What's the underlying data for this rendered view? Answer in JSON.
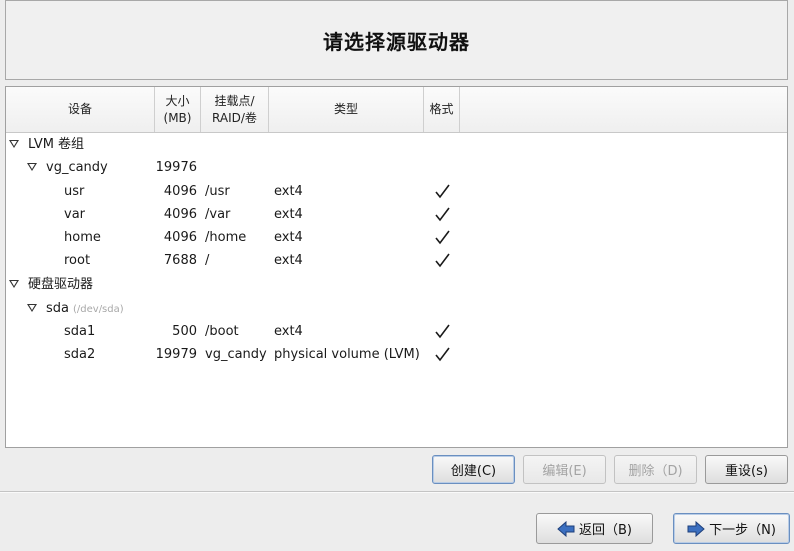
{
  "header": {
    "title": "请选择源驱动器"
  },
  "columns": {
    "device": "设备",
    "size": "大小\n(MB)",
    "mount": "挂载点/\nRAID/卷",
    "type": "类型",
    "format": "格式"
  },
  "rows": [
    {
      "device": "LVM 卷组",
      "level": 0,
      "expander": true
    },
    {
      "device": "vg_candy",
      "level": 1,
      "expander": true,
      "size": "19976"
    },
    {
      "device": "usr",
      "level": 2,
      "size": "4096",
      "mount": "/usr",
      "type": "ext4",
      "format": true
    },
    {
      "device": "var",
      "level": 2,
      "size": "4096",
      "mount": "/var",
      "type": "ext4",
      "format": true
    },
    {
      "device": "home",
      "level": 2,
      "size": "4096",
      "mount": "/home",
      "type": "ext4",
      "format": true
    },
    {
      "device": "root",
      "level": 2,
      "size": "7688",
      "mount": "/",
      "type": "ext4",
      "format": true
    },
    {
      "device": "硬盘驱动器",
      "level": 0,
      "expander": true
    },
    {
      "device": "sda",
      "level": 1,
      "expander": true,
      "sub": "(/dev/sda)"
    },
    {
      "device": "sda1",
      "level": 2,
      "size": "500",
      "mount": "/boot",
      "type": "ext4",
      "format": true
    },
    {
      "device": "sda2",
      "level": 2,
      "size": "19979",
      "mount": "vg_candy",
      "type": "physical volume (LVM)",
      "format": true
    }
  ],
  "actions": {
    "create": "创建(C)",
    "edit": "编辑(E)",
    "delete": "删除（D)",
    "reset": "重设(s)"
  },
  "nav": {
    "back": "返回（B)",
    "next": "下一步（N)"
  },
  "colors": {
    "arrow": "#2f5fa8",
    "disabled_text": "#a3a3a3"
  }
}
